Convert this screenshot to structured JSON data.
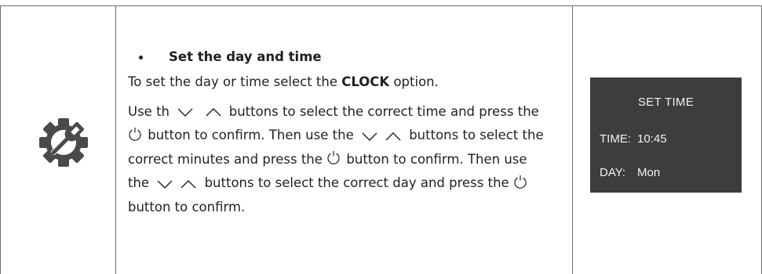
{
  "section": {
    "heading": "Set the day and time",
    "intro_prefix": "To set the day or time select the ",
    "intro_bold": "CLOCK",
    "intro_suffix": " option.",
    "p_a": "Use th",
    "p_b": " buttons to select the correct time and press the",
    "p_c": " button to confirm. Then use the ",
    "p_d": " buttons to select the",
    "p_e": "correct minutes and press the ",
    "p_f": " button to confirm. Then use",
    "p_g": "the ",
    "p_h": " buttons to select the correct day and press the ",
    "p_i": "button to confirm."
  },
  "icons": {
    "settings": "gear-wrench-icon",
    "down": "chevron-down-icon",
    "up": "chevron-up-icon",
    "power": "power-icon"
  },
  "display": {
    "title": "SET TIME",
    "time_label": "TIME:",
    "time_value": "10:45",
    "day_label": "DAY:",
    "day_value": "Mon",
    "background": "#3d3d3d"
  }
}
